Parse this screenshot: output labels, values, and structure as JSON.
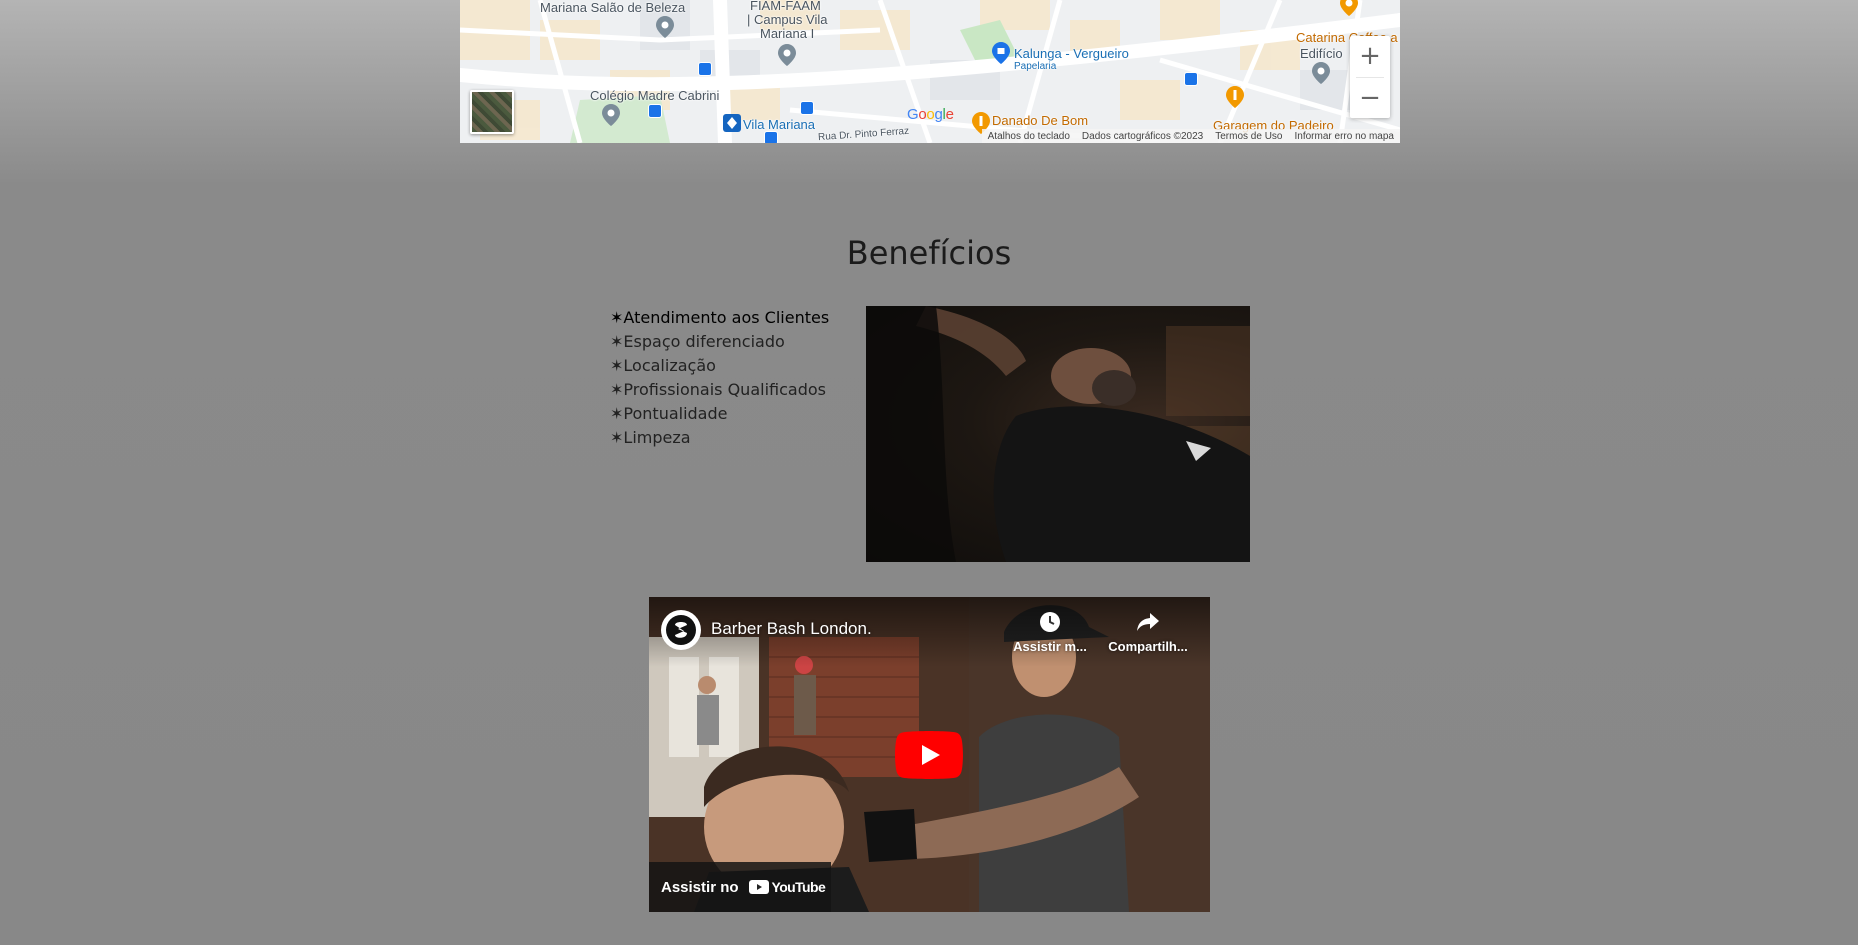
{
  "map": {
    "labels": {
      "salon": "Mariana Salão de Beleza",
      "fiam_line1": "FIAM-FAAM",
      "fiam_line2": "| Campus Vila",
      "fiam_line3": "Mariana I",
      "kalunga": "Kalunga - Vergueiro",
      "papelaria": "Papelaria",
      "catarina": "Catarina Coffee a",
      "edificio": "Edifício",
      "colegio": "Colégio Madre Cabrini",
      "vila_mariana": "Vila Mariana",
      "rua": "Rua Dr. Pinto Ferraz",
      "danado": "Danado De Bom",
      "garagem": "Garagem do Padeiro"
    },
    "google_logo": "Google",
    "zoom_in": "+",
    "zoom_out": "−",
    "footer": {
      "shortcuts": "Atalhos do teclado",
      "map_data": "Dados cartográficos ©2023",
      "terms": "Termos de Uso",
      "report": "Informar erro no mapa"
    }
  },
  "benefits": {
    "title": "Benefícios",
    "items": [
      "✶Atendimento aos Clientes",
      "✶Espaço diferenciado",
      "✶Localização",
      "✶Profissionais Qualificados",
      "✶Pontualidade",
      "✶Limpeza"
    ]
  },
  "video": {
    "title": "Barber Bash London.",
    "watch_later": "Assistir m...",
    "share": "Compartilh...",
    "watch_on": "Assistir no",
    "youtube": "YouTube"
  },
  "colors": {
    "youtube_red": "#ff0000",
    "map_blue": "#1a73e8",
    "map_orange": "#f29900"
  }
}
